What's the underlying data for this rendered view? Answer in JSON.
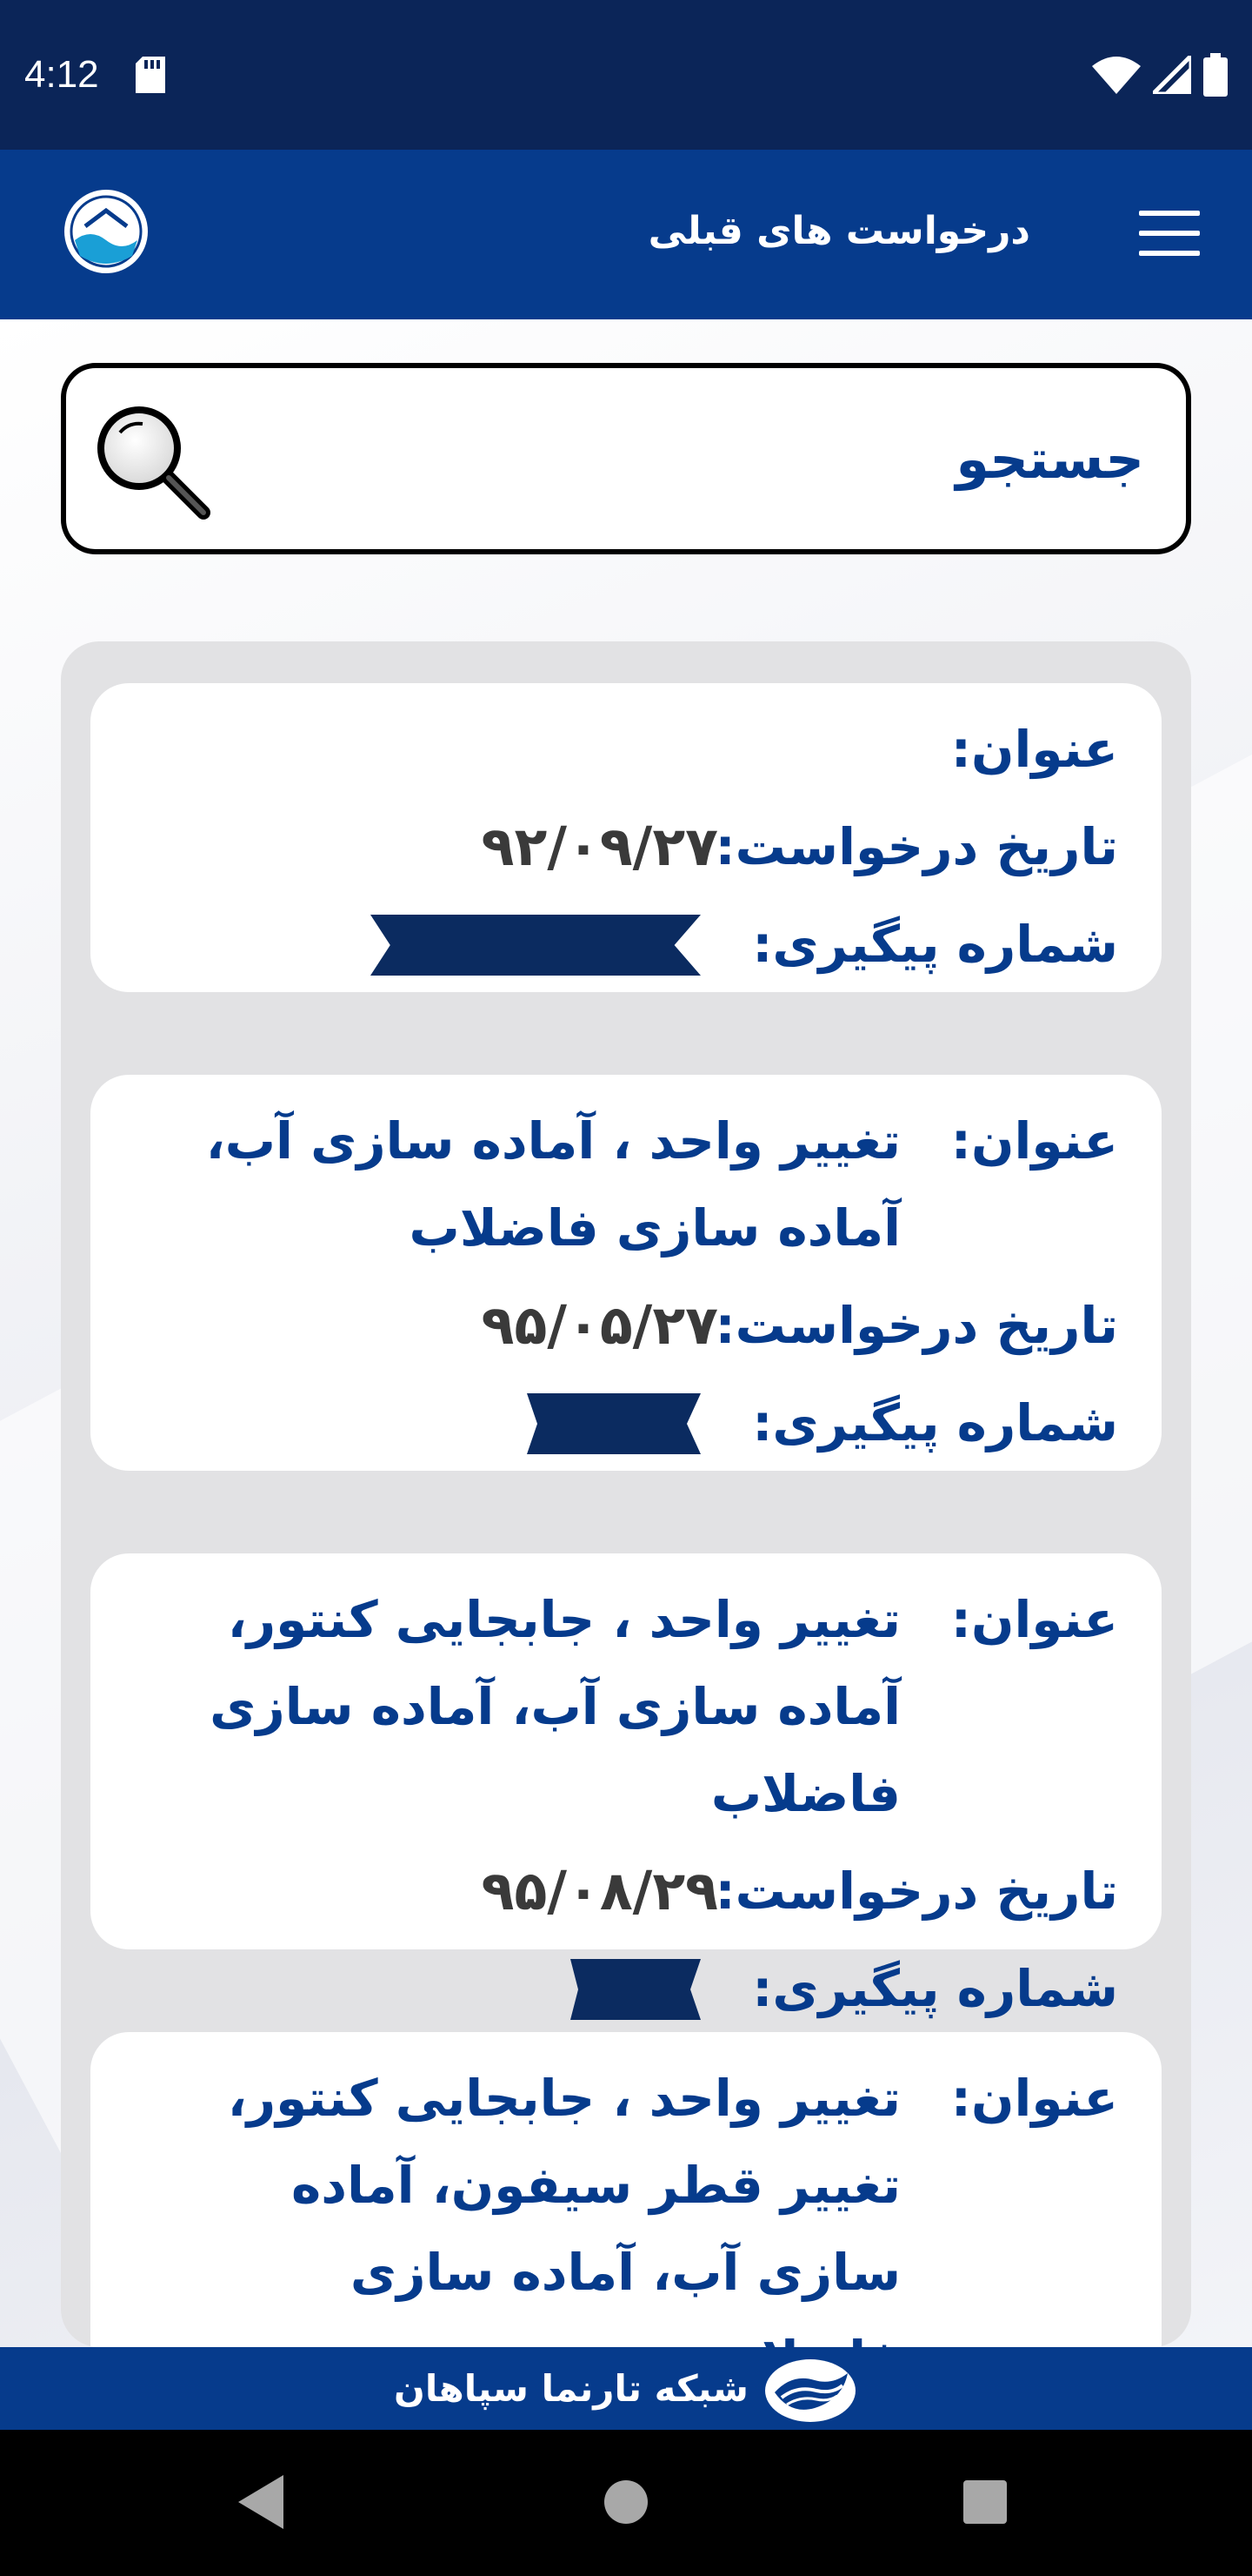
{
  "status_bar": {
    "time": "4:12",
    "icons": [
      "sd-card-icon",
      "wifi-icon",
      "signal-icon",
      "battery-icon"
    ]
  },
  "app_bar": {
    "title": "درخواست های قبلی",
    "logo": "water-company-logo",
    "menu_icon": "hamburger-menu-icon"
  },
  "search": {
    "label": "جستجو",
    "icon": "magnifier-icon"
  },
  "requests": [
    {
      "title_label": "عنوان:",
      "title_value": "",
      "date_label": "تاریخ درخواست:",
      "date_value": "۹۲/۰۹/۲۷",
      "tracking_label": "شماره پیگیری:",
      "tracking_value": "redacted"
    },
    {
      "title_label": "عنوان:",
      "title_value": "تغییر واحد ، آماده سازی آب، آماده سازی فاضلاب",
      "date_label": "تاریخ درخواست:",
      "date_value": "۹۵/۰۵/۲۷",
      "tracking_label": "شماره پیگیری:",
      "tracking_value": "redacted"
    },
    {
      "title_label": "عنوان:",
      "title_value": "تغییر واحد ، جابجایی کنتور، آماده سازی آب، آماده سازی فاضلاب",
      "date_label": "تاریخ درخواست:",
      "date_value": "۹۵/۰۸/۲۹",
      "tracking_label": "شماره پیگیری:",
      "tracking_value": "redacted"
    },
    {
      "title_label": "عنوان:",
      "title_value": "تغییر واحد ، جابجایی کنتور، تغییر قطر سیفون، آماده سازی آب، آماده سازی فاضلاب"
    }
  ],
  "footer": {
    "text": "شبکه تارنما سپاهان",
    "logo": "tarnama-logo"
  },
  "nav_bar": {
    "icons": [
      "back-icon",
      "home-icon",
      "recents-icon"
    ]
  },
  "colors": {
    "status_bar": "#0b2558",
    "primary": "#063b8c",
    "panel": "#e2e2e4",
    "date_text": "#3a3a3a"
  }
}
